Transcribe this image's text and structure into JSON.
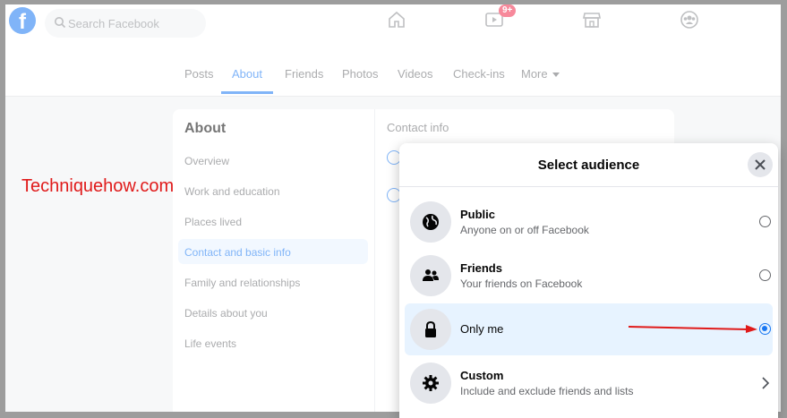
{
  "watermark": "Techniquehow.com",
  "topbar": {
    "search_placeholder": "Search Facebook",
    "watch_badge": "9+"
  },
  "profile_tabs": [
    {
      "label": "Posts"
    },
    {
      "label": "About"
    },
    {
      "label": "Friends"
    },
    {
      "label": "Photos"
    },
    {
      "label": "Videos"
    },
    {
      "label": "Check-ins"
    },
    {
      "label": "More"
    }
  ],
  "about": {
    "title": "About",
    "items": [
      {
        "label": "Overview"
      },
      {
        "label": "Work and education"
      },
      {
        "label": "Places lived"
      },
      {
        "label": "Contact and basic info"
      },
      {
        "label": "Family and relationships"
      },
      {
        "label": "Details about you"
      },
      {
        "label": "Life events"
      }
    ],
    "contact_title": "Contact info"
  },
  "modal": {
    "title": "Select audience",
    "options": [
      {
        "label": "Public",
        "sub": "Anyone on or off Facebook",
        "icon": "globe-icon",
        "selected": false
      },
      {
        "label": "Friends",
        "sub": "Your friends on Facebook",
        "icon": "friends-icon",
        "selected": false
      },
      {
        "label": "Only me",
        "sub": "",
        "icon": "lock-icon",
        "selected": true
      },
      {
        "label": "Custom",
        "sub": "Include and exclude friends and lists",
        "icon": "gear-icon",
        "selected": false
      }
    ]
  },
  "colors": {
    "accent": "#1877f2",
    "arrow": "#e01a1a"
  }
}
